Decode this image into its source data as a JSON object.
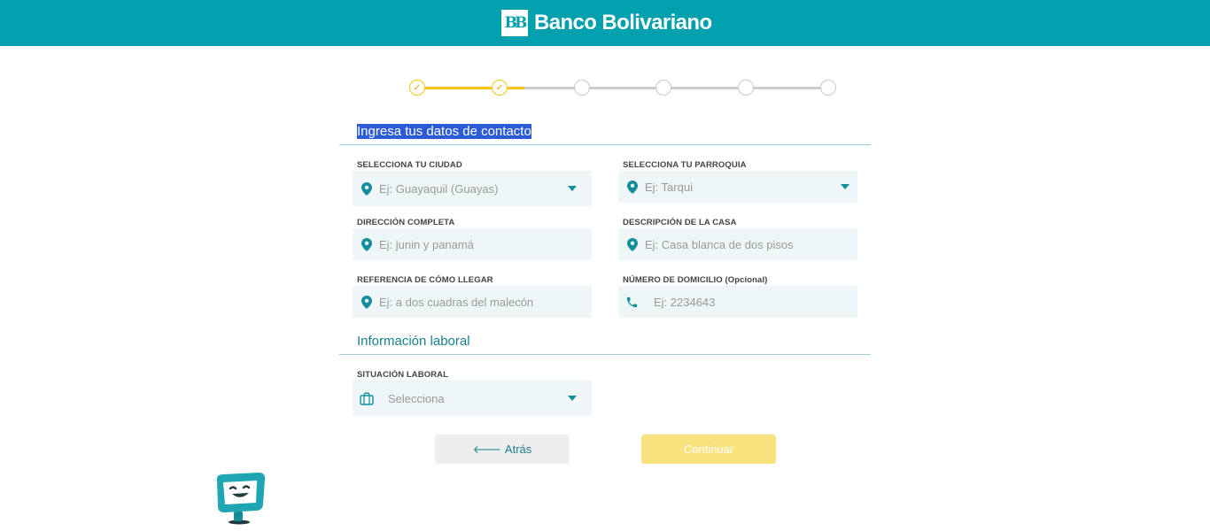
{
  "header": {
    "logo_text": "BB",
    "brand": "Banco Bolivariano"
  },
  "stepper": {
    "total_steps": 6,
    "completed_steps": 2,
    "done_mark": "✓"
  },
  "contact": {
    "title": "Ingresa tus datos de contacto",
    "city": {
      "label": "SELECCIONA TU CIUDAD",
      "placeholder": "Ej: Guayaquil (Guayas)"
    },
    "parish": {
      "label": "SELECCIONA TU PARROQUIA",
      "placeholder": "Ej: Tarqui"
    },
    "address": {
      "label": "DIRECCIÓN COMPLETA",
      "placeholder": "Ej: junin y panamá"
    },
    "house": {
      "label": "DESCRIPCIÓN DE LA CASA",
      "placeholder": "Ej: Casa blanca de dos pisos"
    },
    "reference": {
      "label": "REFERENCIA DE CÓMO LLEGAR",
      "placeholder": "Ej: a dos cuadras del malecón"
    },
    "phone": {
      "label": "NÚMERO DE DOMICILIO (Opcional)",
      "placeholder": "Ej: 2234643"
    }
  },
  "work": {
    "title": "Información laboral",
    "situation": {
      "label": "SITUACIÓN LABORAL",
      "placeholder": "Selecciona"
    }
  },
  "actions": {
    "back": "Atrás",
    "back_arrow": "🡐",
    "continue": "Continuar"
  },
  "colors": {
    "brand": "#00a0ae",
    "accent": "#f5c518",
    "field_bg": "#eef6f7",
    "continue_bg": "#f7e27e"
  }
}
